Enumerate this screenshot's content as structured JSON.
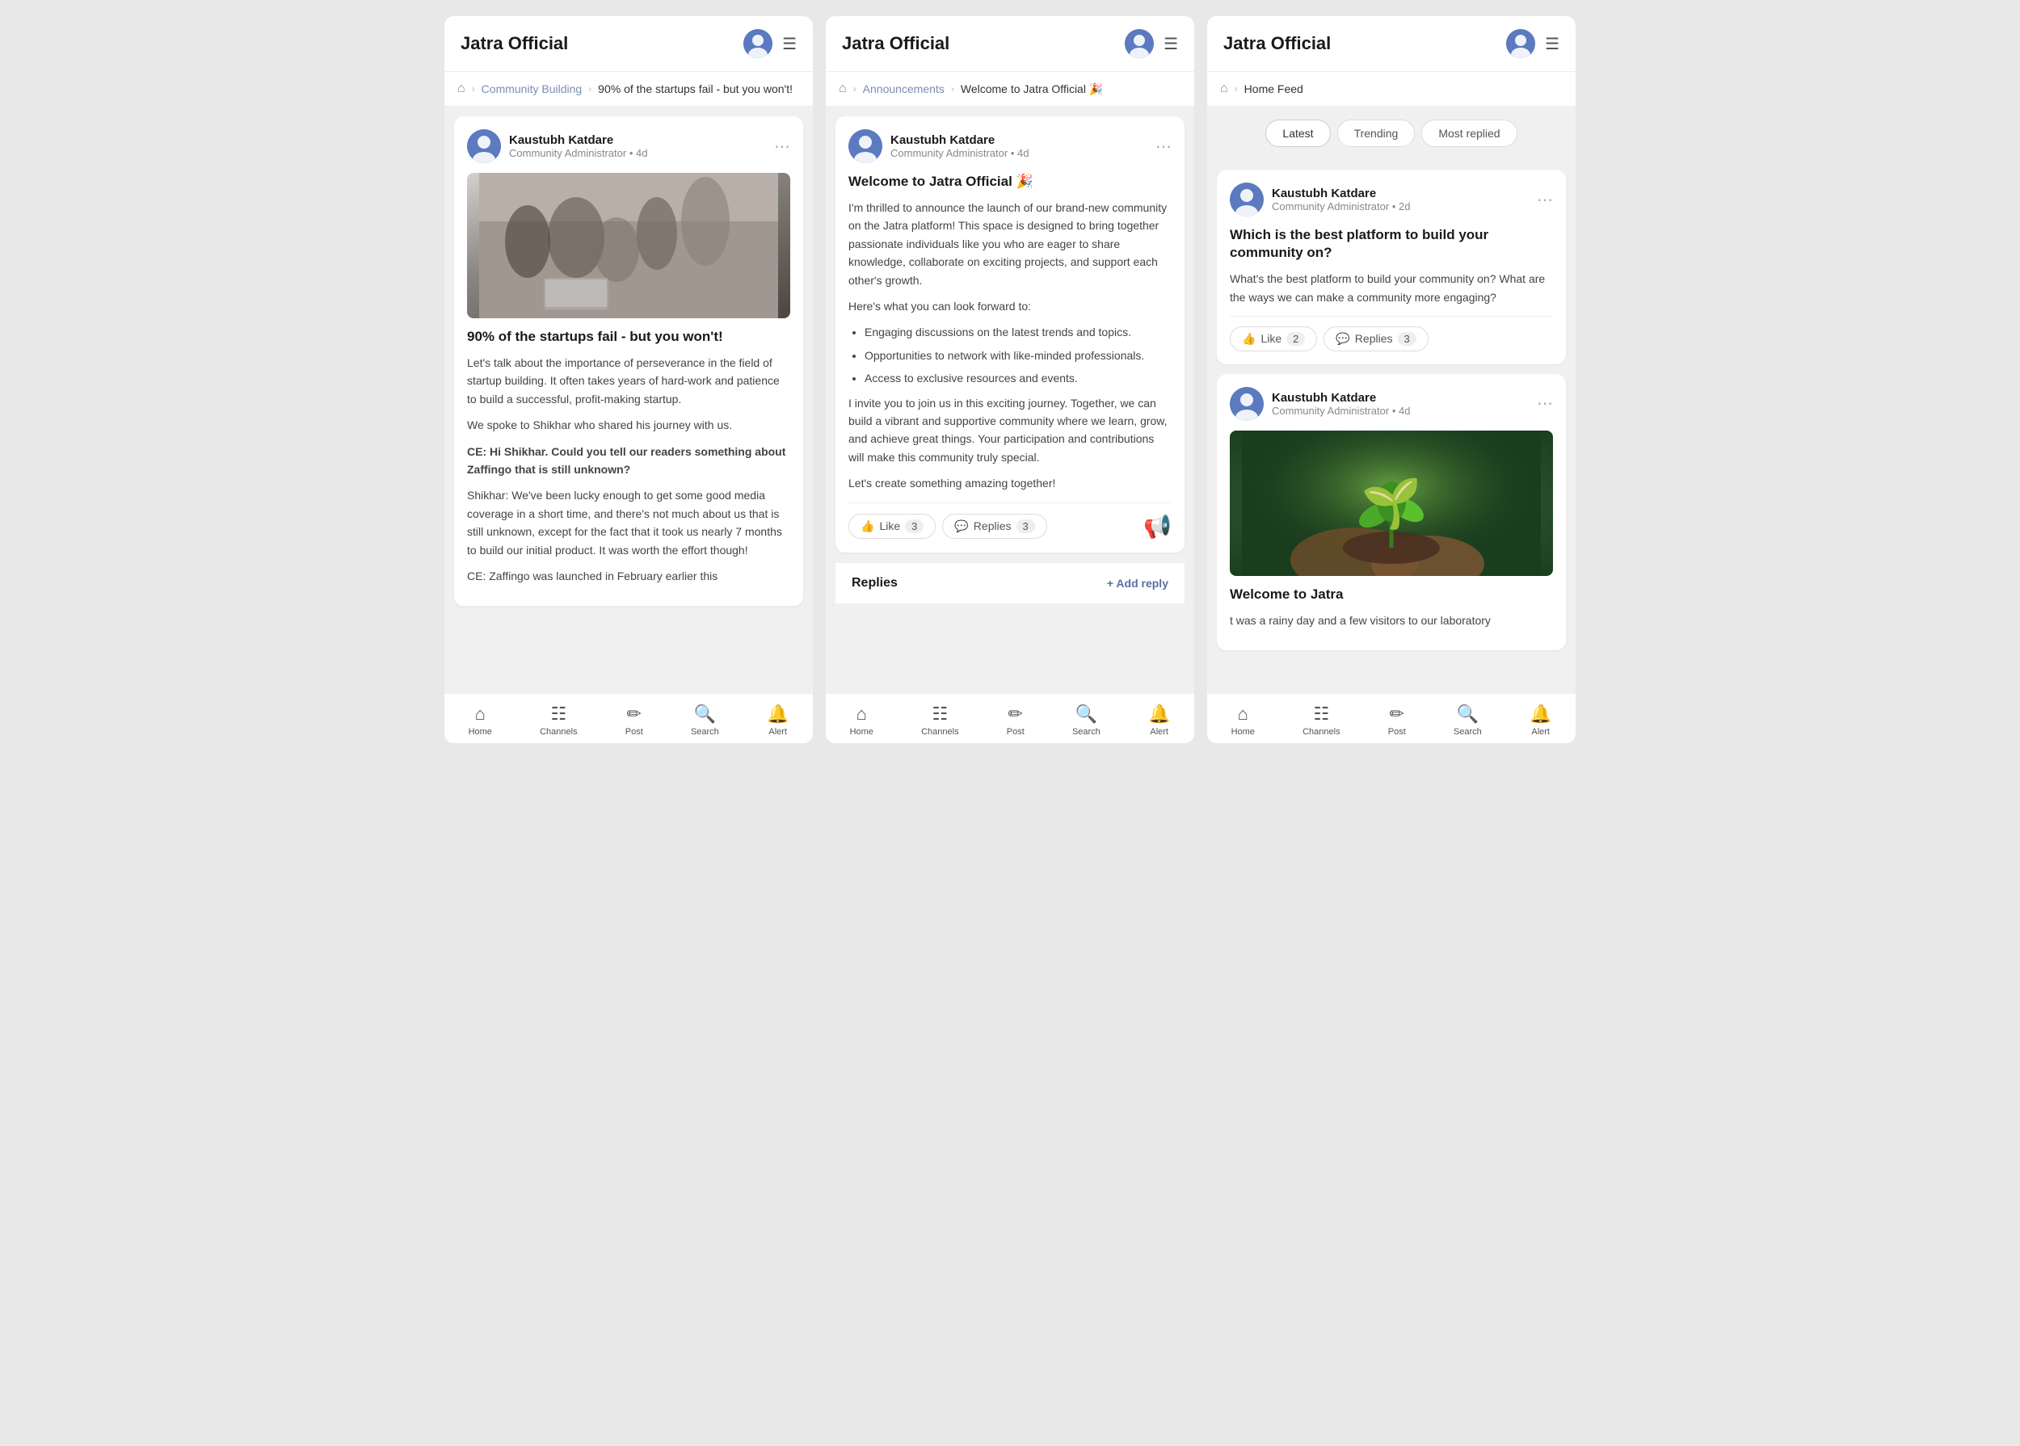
{
  "screens": [
    {
      "id": "screen1",
      "header": {
        "title": "Jatra Official",
        "menu_label": "menu"
      },
      "breadcrumb": {
        "home": "home",
        "items": [
          "Community Building",
          "90% of the startups fail - but you won't!"
        ]
      },
      "post": {
        "author_name": "Kaustubh Katdare",
        "author_meta": "Community Administrator • 4d",
        "image_type": "team",
        "title": "90% of the startups fail - but you won't!",
        "paragraphs": [
          "Let's talk about the importance of perseverance in the field of startup building. It often takes years of hard-work and patience to build a successful, profit-making startup.",
          "We spoke to Shikhar who shared his journey with us."
        ],
        "bold_para": "CE:  Hi Shikhar. Could you tell our readers something about Zaffingo that is still unknown?",
        "body_continued": "Shikhar: We've been lucky enough to get some good media coverage in a short time, and there's not much about us that is still unknown, except for the fact that it took us nearly 7 months to build our initial product. It was worth the effort though!",
        "trailing": "CE: Zaffingo was launched in February earlier this"
      },
      "nav": {
        "items": [
          "Home",
          "Channels",
          "Post",
          "Search",
          "Alert"
        ]
      }
    },
    {
      "id": "screen2",
      "header": {
        "title": "Jatra Official",
        "menu_label": "menu"
      },
      "breadcrumb": {
        "home": "home",
        "items": [
          "Announcements",
          "Welcome to Jatra Official 🎉"
        ]
      },
      "post": {
        "author_name": "Kaustubh Katdare",
        "author_meta": "Community Administrator • 4d",
        "title": "Welcome to Jatra Official 🎉",
        "intro": "I'm thrilled to announce the launch of our brand-new community on the Jatra platform! This space is designed to bring together passionate individuals like you who are eager to share knowledge, collaborate on exciting projects, and support each other's growth.",
        "list_header": "Here's what you can look forward to:",
        "list_items": [
          "Engaging discussions on the latest trends and topics.",
          "Opportunities to network with like-minded professionals.",
          "Access to exclusive resources and events."
        ],
        "outro": "I invite you to join us in this exciting journey. Together, we can build a vibrant and supportive community where we learn, grow, and achieve great things. Your participation and contributions will make this community truly special.",
        "closing": "Let's create something amazing together!",
        "like_count": "3",
        "reply_count": "3"
      },
      "replies_section": {
        "label": "Replies",
        "add_reply": "+ Add reply"
      },
      "nav": {
        "items": [
          "Home",
          "Channels",
          "Post",
          "Search",
          "Alert"
        ]
      }
    },
    {
      "id": "screen3",
      "header": {
        "title": "Jatra Official",
        "menu_label": "menu"
      },
      "breadcrumb": {
        "home": "home",
        "items": [
          "Home Feed"
        ]
      },
      "tabs": {
        "items": [
          "Latest",
          "Trending",
          "Most replied"
        ],
        "active": "Latest"
      },
      "posts": [
        {
          "author_name": "Kaustubh Katdare",
          "author_meta": "Community Administrator • 2d",
          "title": "Which is the best platform to build your community on?",
          "body": "What's the best platform to build your community on? What are the ways we can make a community more engaging?",
          "like_count": "2",
          "reply_count": "3"
        },
        {
          "author_name": "Kaustubh Katdare",
          "author_meta": "Community Administrator • 4d",
          "image_type": "plant",
          "title": "Welcome to Jatra",
          "body": "t was a rainy day and a few visitors to our laboratory"
        }
      ],
      "nav": {
        "items": [
          "Home",
          "Channels",
          "Post",
          "Search",
          "Alert"
        ]
      }
    }
  ]
}
